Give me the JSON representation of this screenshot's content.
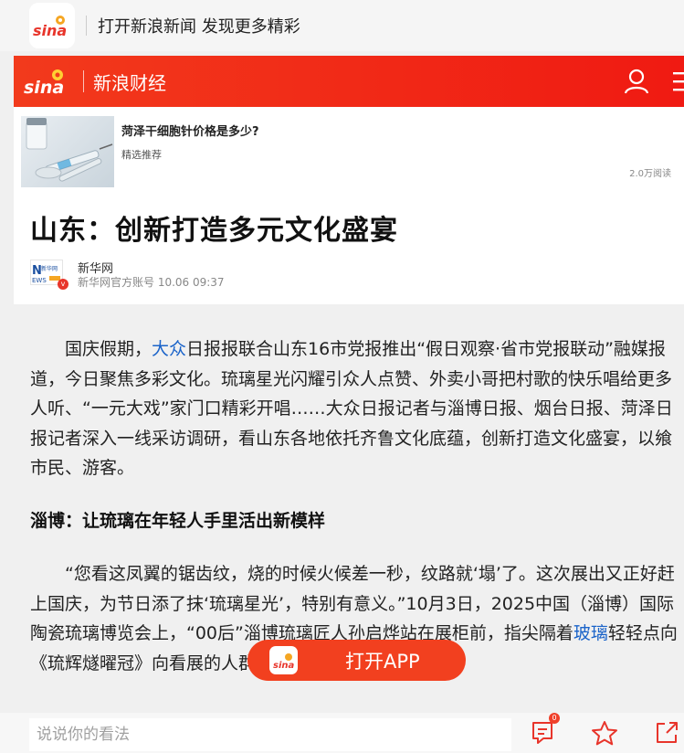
{
  "topbar": {
    "promo_text": "打开新浪新闻 发现更多精彩",
    "logo_text": "sina"
  },
  "header": {
    "logo_text": "sina",
    "channel": "新浪财经"
  },
  "ad": {
    "title": "菏泽干细胞针价格是多少?",
    "tag": "精选推荐",
    "reads": "2.0万阅读"
  },
  "article": {
    "title": "山东：创新打造多元文化盛宴",
    "author": {
      "name": "新华网",
      "meta": "新华网官方账号  10.06  09:37",
      "badge": "v"
    },
    "p1_pre": "国庆假期，",
    "p1_link": "大众",
    "p1_post": "日报报联合山东16市党报推出“假日观察·省市党报联动”融媒报道，今日聚焦多彩文化。琉璃星光闪耀引众人点赞、外卖小哥把村歌的快乐唱给更多人听、“一元大戏”家门口精彩开唱……大众日报记者与淄博日报、烟台日报、菏泽日报记者深入一线采访调研，看山东各地依托齐鲁文化底蕴，创新打造文化盛宴，以飨市民、游客。",
    "section1": "淄博：让琉璃在年轻人手里活出新模样",
    "p2_pre": "“您看这凤翼的锯齿纹，烧的时候火候差一秒，纹路就‘塌’了。这次展出又正好赶上国庆，为节日添了抹‘琉璃星光’，特别有意义。”10月3日，2025中国（淄博）国际陶瓷琉璃博览会上，“00后”淄博琉璃匠人孙启烨站在展柜前，指尖隔着",
    "p2_link": "玻璃",
    "p2_post": "轻轻点向《琉辉燧曜冠》向看展的人群介绍"
  },
  "open_app": {
    "label": "打开APP"
  },
  "bottom": {
    "comment_placeholder": "说说你的看法",
    "comment_count": "0"
  },
  "colors": {
    "brand_red": "#f2401f",
    "link_blue": "#1a63c9"
  }
}
